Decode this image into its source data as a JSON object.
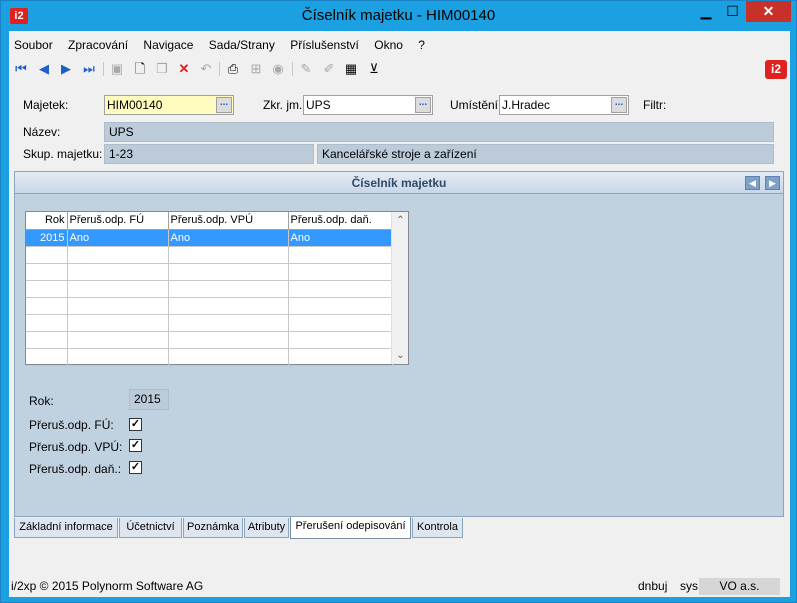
{
  "window": {
    "title": "Číselník majetku - HIM00140",
    "app_icon_text": "i2",
    "minimize_glyph": "▁",
    "maximize_glyph": "☐",
    "close_glyph": "✕"
  },
  "menu": [
    "Soubor",
    "Zpracování",
    "Navigace",
    "Sada/Strany",
    "Příslušenství",
    "Okno",
    "?"
  ],
  "toolbar": {
    "icons": [
      "first-record-icon",
      "previous-record-icon",
      "next-record-icon",
      "last-record-icon",
      "save-icon",
      "new-record-icon",
      "copy-icon",
      "delete-icon",
      "undo-icon",
      "print-icon",
      "tree-icon",
      "lock-icon",
      "edit-icon",
      "clear-icon",
      "table-lookup-icon",
      "filter-icon"
    ],
    "logo_text": "i2"
  },
  "form": {
    "majetek_label": "Majetek:",
    "majetek_value": "HIM00140",
    "zkr_label": "Zkr. jm.:",
    "zkr_value": "UPS",
    "umisteni_label": "Umístění:",
    "umisteni_value": "J.Hradec",
    "filtr_label": "Filtr:",
    "nazev_label": "Název:",
    "nazev_value": "UPS",
    "skup_label": "Skup. majetku:",
    "skup_code": "1-23",
    "skup_name": "Kancelářské stroje a zařízení",
    "lookup_btn": "..."
  },
  "panel": {
    "title": "Číselník majetku",
    "left_arrow": "◀",
    "right_arrow": "▶"
  },
  "grid": {
    "columns": [
      "Rok",
      "Přeruš.odp. FÚ",
      "Přeruš.odp. VPÚ",
      "Přeruš.odp. daň."
    ],
    "rows": [
      [
        "2015",
        "Ano",
        "Ano",
        "Ano"
      ]
    ],
    "scroll_up": "⌃",
    "scroll_down": "⌄"
  },
  "detail": {
    "rok_label": "Rok:",
    "rok_value": "2015",
    "fu_label": "Přeruš.odp. FÚ:",
    "fu_checked": true,
    "vpu_label": "Přeruš.odp. VPÚ:",
    "vpu_checked": true,
    "dan_label": "Přeruš.odp. daň.:",
    "dan_checked": true,
    "check_glyph": "✓"
  },
  "tabs": [
    "Základní informace",
    "Účetnictví",
    "Poznámka",
    "Atributy",
    "Přerušení odepisování",
    "Kontrola"
  ],
  "active_tab": "Přerušení odepisování",
  "status": {
    "copyright": "i/2xp © 2015 Polynorm Software AG",
    "user": "dnbuj",
    "db": "sys",
    "company": "VO a.s."
  }
}
